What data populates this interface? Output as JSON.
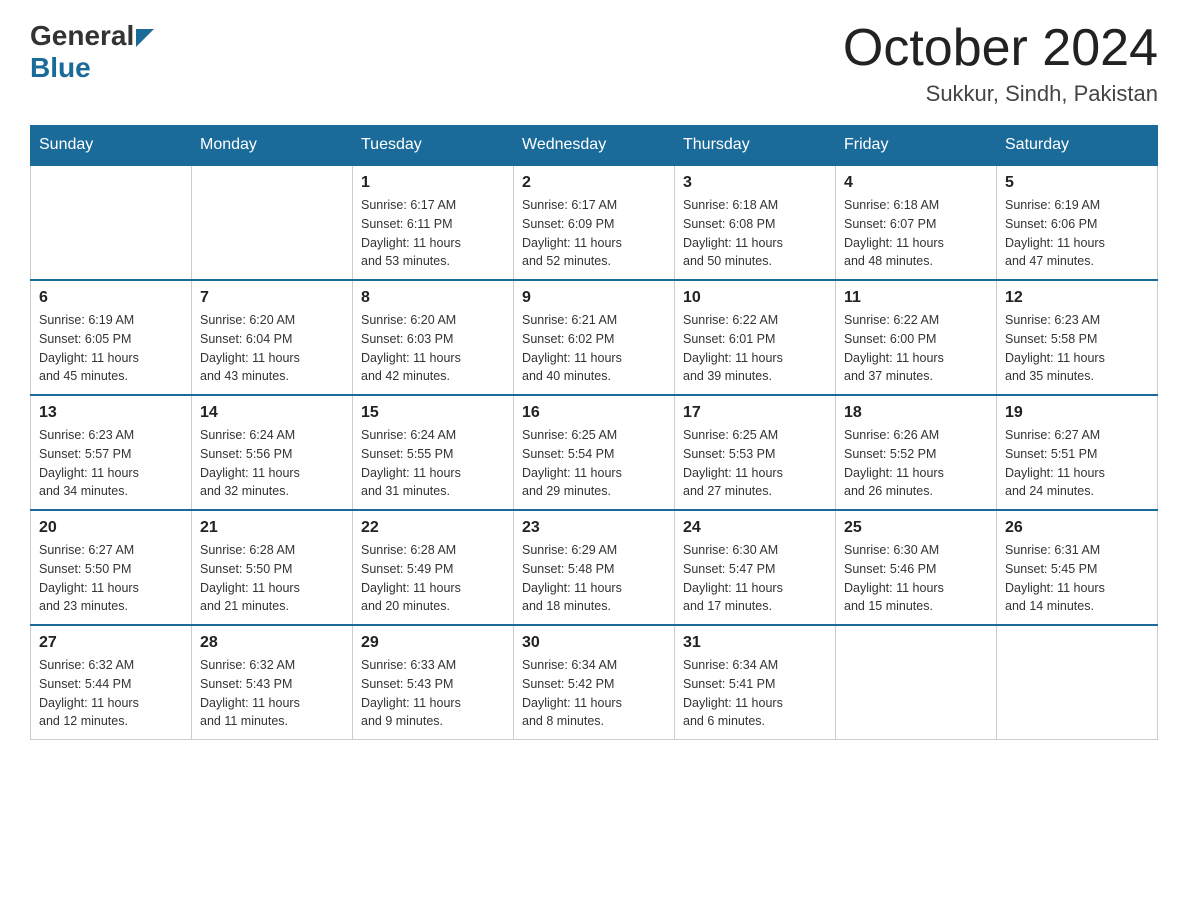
{
  "header": {
    "logo_general": "General",
    "logo_blue": "Blue",
    "title": "October 2024",
    "subtitle": "Sukkur, Sindh, Pakistan"
  },
  "weekdays": [
    "Sunday",
    "Monday",
    "Tuesday",
    "Wednesday",
    "Thursday",
    "Friday",
    "Saturday"
  ],
  "weeks": [
    [
      {
        "day": "",
        "info": ""
      },
      {
        "day": "",
        "info": ""
      },
      {
        "day": "1",
        "info": "Sunrise: 6:17 AM\nSunset: 6:11 PM\nDaylight: 11 hours\nand 53 minutes."
      },
      {
        "day": "2",
        "info": "Sunrise: 6:17 AM\nSunset: 6:09 PM\nDaylight: 11 hours\nand 52 minutes."
      },
      {
        "day": "3",
        "info": "Sunrise: 6:18 AM\nSunset: 6:08 PM\nDaylight: 11 hours\nand 50 minutes."
      },
      {
        "day": "4",
        "info": "Sunrise: 6:18 AM\nSunset: 6:07 PM\nDaylight: 11 hours\nand 48 minutes."
      },
      {
        "day": "5",
        "info": "Sunrise: 6:19 AM\nSunset: 6:06 PM\nDaylight: 11 hours\nand 47 minutes."
      }
    ],
    [
      {
        "day": "6",
        "info": "Sunrise: 6:19 AM\nSunset: 6:05 PM\nDaylight: 11 hours\nand 45 minutes."
      },
      {
        "day": "7",
        "info": "Sunrise: 6:20 AM\nSunset: 6:04 PM\nDaylight: 11 hours\nand 43 minutes."
      },
      {
        "day": "8",
        "info": "Sunrise: 6:20 AM\nSunset: 6:03 PM\nDaylight: 11 hours\nand 42 minutes."
      },
      {
        "day": "9",
        "info": "Sunrise: 6:21 AM\nSunset: 6:02 PM\nDaylight: 11 hours\nand 40 minutes."
      },
      {
        "day": "10",
        "info": "Sunrise: 6:22 AM\nSunset: 6:01 PM\nDaylight: 11 hours\nand 39 minutes."
      },
      {
        "day": "11",
        "info": "Sunrise: 6:22 AM\nSunset: 6:00 PM\nDaylight: 11 hours\nand 37 minutes."
      },
      {
        "day": "12",
        "info": "Sunrise: 6:23 AM\nSunset: 5:58 PM\nDaylight: 11 hours\nand 35 minutes."
      }
    ],
    [
      {
        "day": "13",
        "info": "Sunrise: 6:23 AM\nSunset: 5:57 PM\nDaylight: 11 hours\nand 34 minutes."
      },
      {
        "day": "14",
        "info": "Sunrise: 6:24 AM\nSunset: 5:56 PM\nDaylight: 11 hours\nand 32 minutes."
      },
      {
        "day": "15",
        "info": "Sunrise: 6:24 AM\nSunset: 5:55 PM\nDaylight: 11 hours\nand 31 minutes."
      },
      {
        "day": "16",
        "info": "Sunrise: 6:25 AM\nSunset: 5:54 PM\nDaylight: 11 hours\nand 29 minutes."
      },
      {
        "day": "17",
        "info": "Sunrise: 6:25 AM\nSunset: 5:53 PM\nDaylight: 11 hours\nand 27 minutes."
      },
      {
        "day": "18",
        "info": "Sunrise: 6:26 AM\nSunset: 5:52 PM\nDaylight: 11 hours\nand 26 minutes."
      },
      {
        "day": "19",
        "info": "Sunrise: 6:27 AM\nSunset: 5:51 PM\nDaylight: 11 hours\nand 24 minutes."
      }
    ],
    [
      {
        "day": "20",
        "info": "Sunrise: 6:27 AM\nSunset: 5:50 PM\nDaylight: 11 hours\nand 23 minutes."
      },
      {
        "day": "21",
        "info": "Sunrise: 6:28 AM\nSunset: 5:50 PM\nDaylight: 11 hours\nand 21 minutes."
      },
      {
        "day": "22",
        "info": "Sunrise: 6:28 AM\nSunset: 5:49 PM\nDaylight: 11 hours\nand 20 minutes."
      },
      {
        "day": "23",
        "info": "Sunrise: 6:29 AM\nSunset: 5:48 PM\nDaylight: 11 hours\nand 18 minutes."
      },
      {
        "day": "24",
        "info": "Sunrise: 6:30 AM\nSunset: 5:47 PM\nDaylight: 11 hours\nand 17 minutes."
      },
      {
        "day": "25",
        "info": "Sunrise: 6:30 AM\nSunset: 5:46 PM\nDaylight: 11 hours\nand 15 minutes."
      },
      {
        "day": "26",
        "info": "Sunrise: 6:31 AM\nSunset: 5:45 PM\nDaylight: 11 hours\nand 14 minutes."
      }
    ],
    [
      {
        "day": "27",
        "info": "Sunrise: 6:32 AM\nSunset: 5:44 PM\nDaylight: 11 hours\nand 12 minutes."
      },
      {
        "day": "28",
        "info": "Sunrise: 6:32 AM\nSunset: 5:43 PM\nDaylight: 11 hours\nand 11 minutes."
      },
      {
        "day": "29",
        "info": "Sunrise: 6:33 AM\nSunset: 5:43 PM\nDaylight: 11 hours\nand 9 minutes."
      },
      {
        "day": "30",
        "info": "Sunrise: 6:34 AM\nSunset: 5:42 PM\nDaylight: 11 hours\nand 8 minutes."
      },
      {
        "day": "31",
        "info": "Sunrise: 6:34 AM\nSunset: 5:41 PM\nDaylight: 11 hours\nand 6 minutes."
      },
      {
        "day": "",
        "info": ""
      },
      {
        "day": "",
        "info": ""
      }
    ]
  ]
}
